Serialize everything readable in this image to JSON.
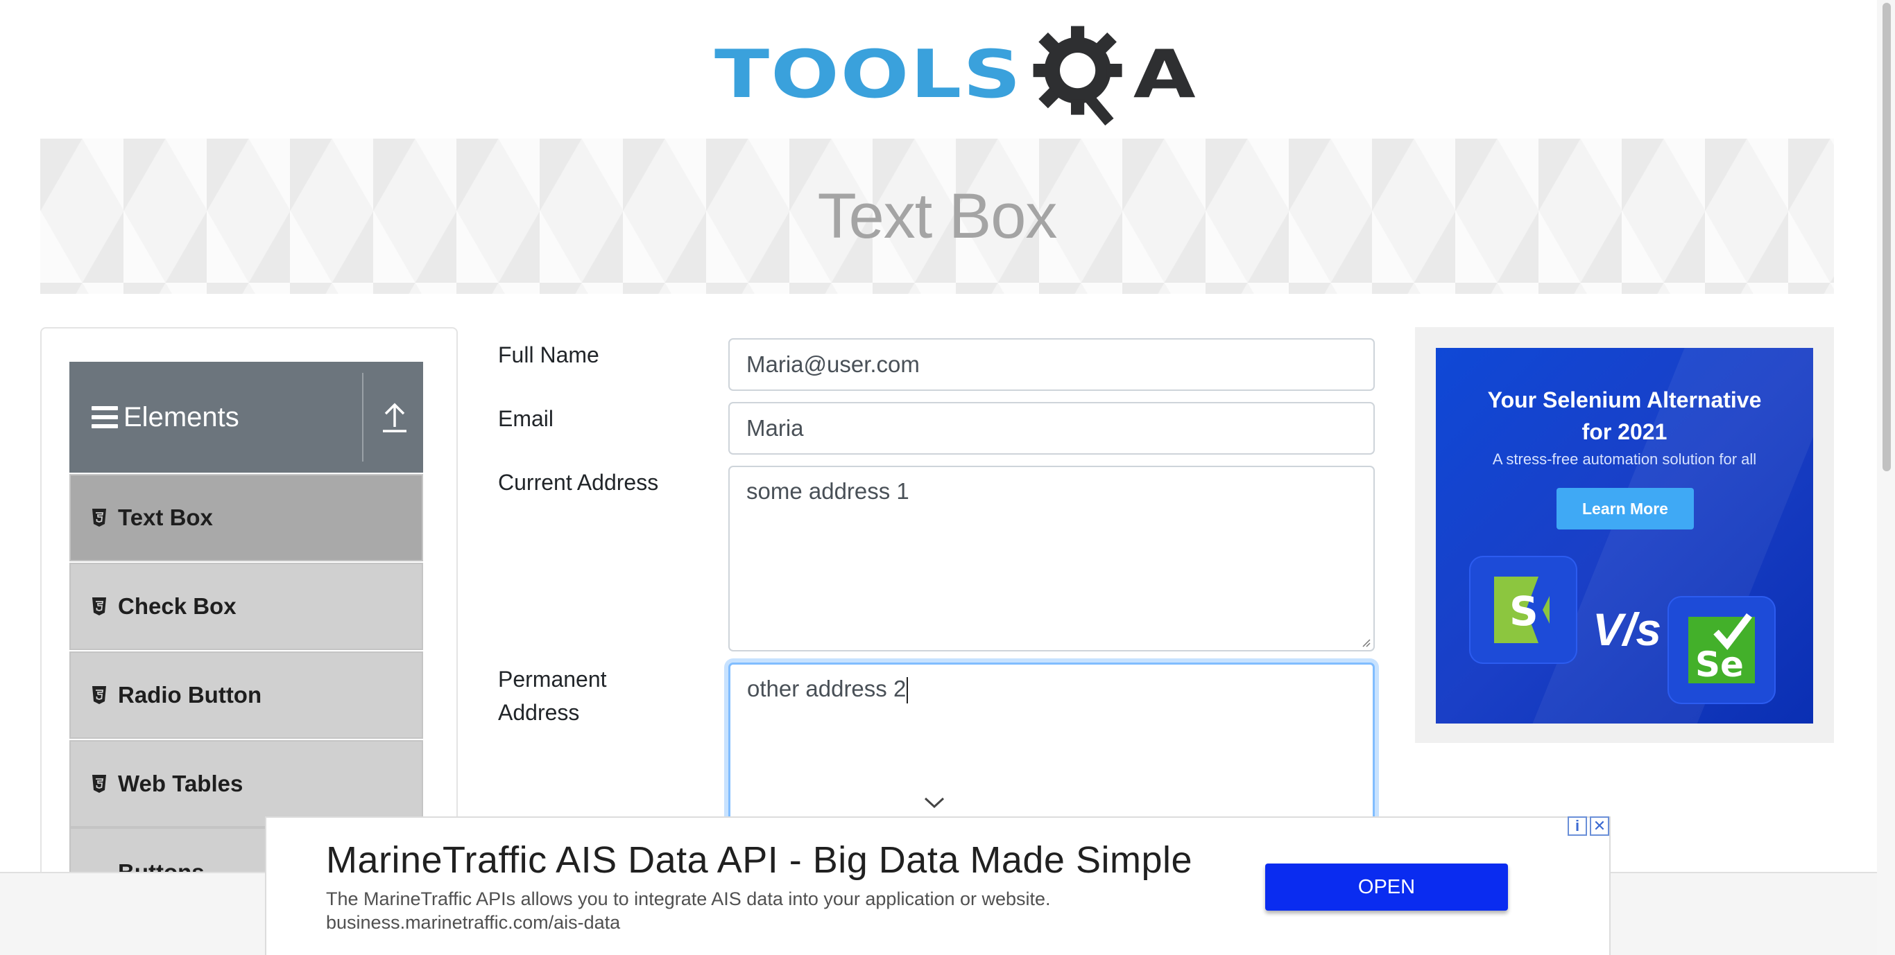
{
  "header": {
    "logo_text": "TOOLS",
    "logo_suffix": "A"
  },
  "banner": {
    "title": "Text Box"
  },
  "sidebar": {
    "group_title": "Elements",
    "items": [
      {
        "label": "Text Box",
        "active": true
      },
      {
        "label": "Check Box"
      },
      {
        "label": "Radio Button"
      },
      {
        "label": "Web Tables"
      },
      {
        "label": "Buttons"
      }
    ]
  },
  "form": {
    "full_name": {
      "label": "Full Name",
      "value": "Maria@user.com"
    },
    "email": {
      "label": "Email",
      "value": "Maria"
    },
    "current_address": {
      "label": "Current Address",
      "value": "some address 1"
    },
    "permanent_address": {
      "label_line1": "Permanent",
      "label_line2": "Address",
      "value": "other address 2"
    }
  },
  "side_ad": {
    "title_line1": "Your Selenium Alternative",
    "title_line2": "for 2021",
    "subtitle": "A stress-free automation solution for all",
    "button": "Learn More",
    "vs_text": "V/s",
    "left_logo": "S",
    "right_logo": "Se"
  },
  "bottom_ad": {
    "title": "MarineTraffic AIS Data API - Big Data Made Simple",
    "description": "The MarineTraffic APIs allows you to integrate AIS data into your application or website.",
    "url": "business.marinetraffic.com/ais-data",
    "button": "OPEN",
    "info_glyph": "i",
    "close_glyph": "✕"
  },
  "colors": {
    "accent": "#3aa1dc",
    "group_header": "#6c757d",
    "focus_border": "#80bdff",
    "open_button": "#0a2cf0"
  }
}
